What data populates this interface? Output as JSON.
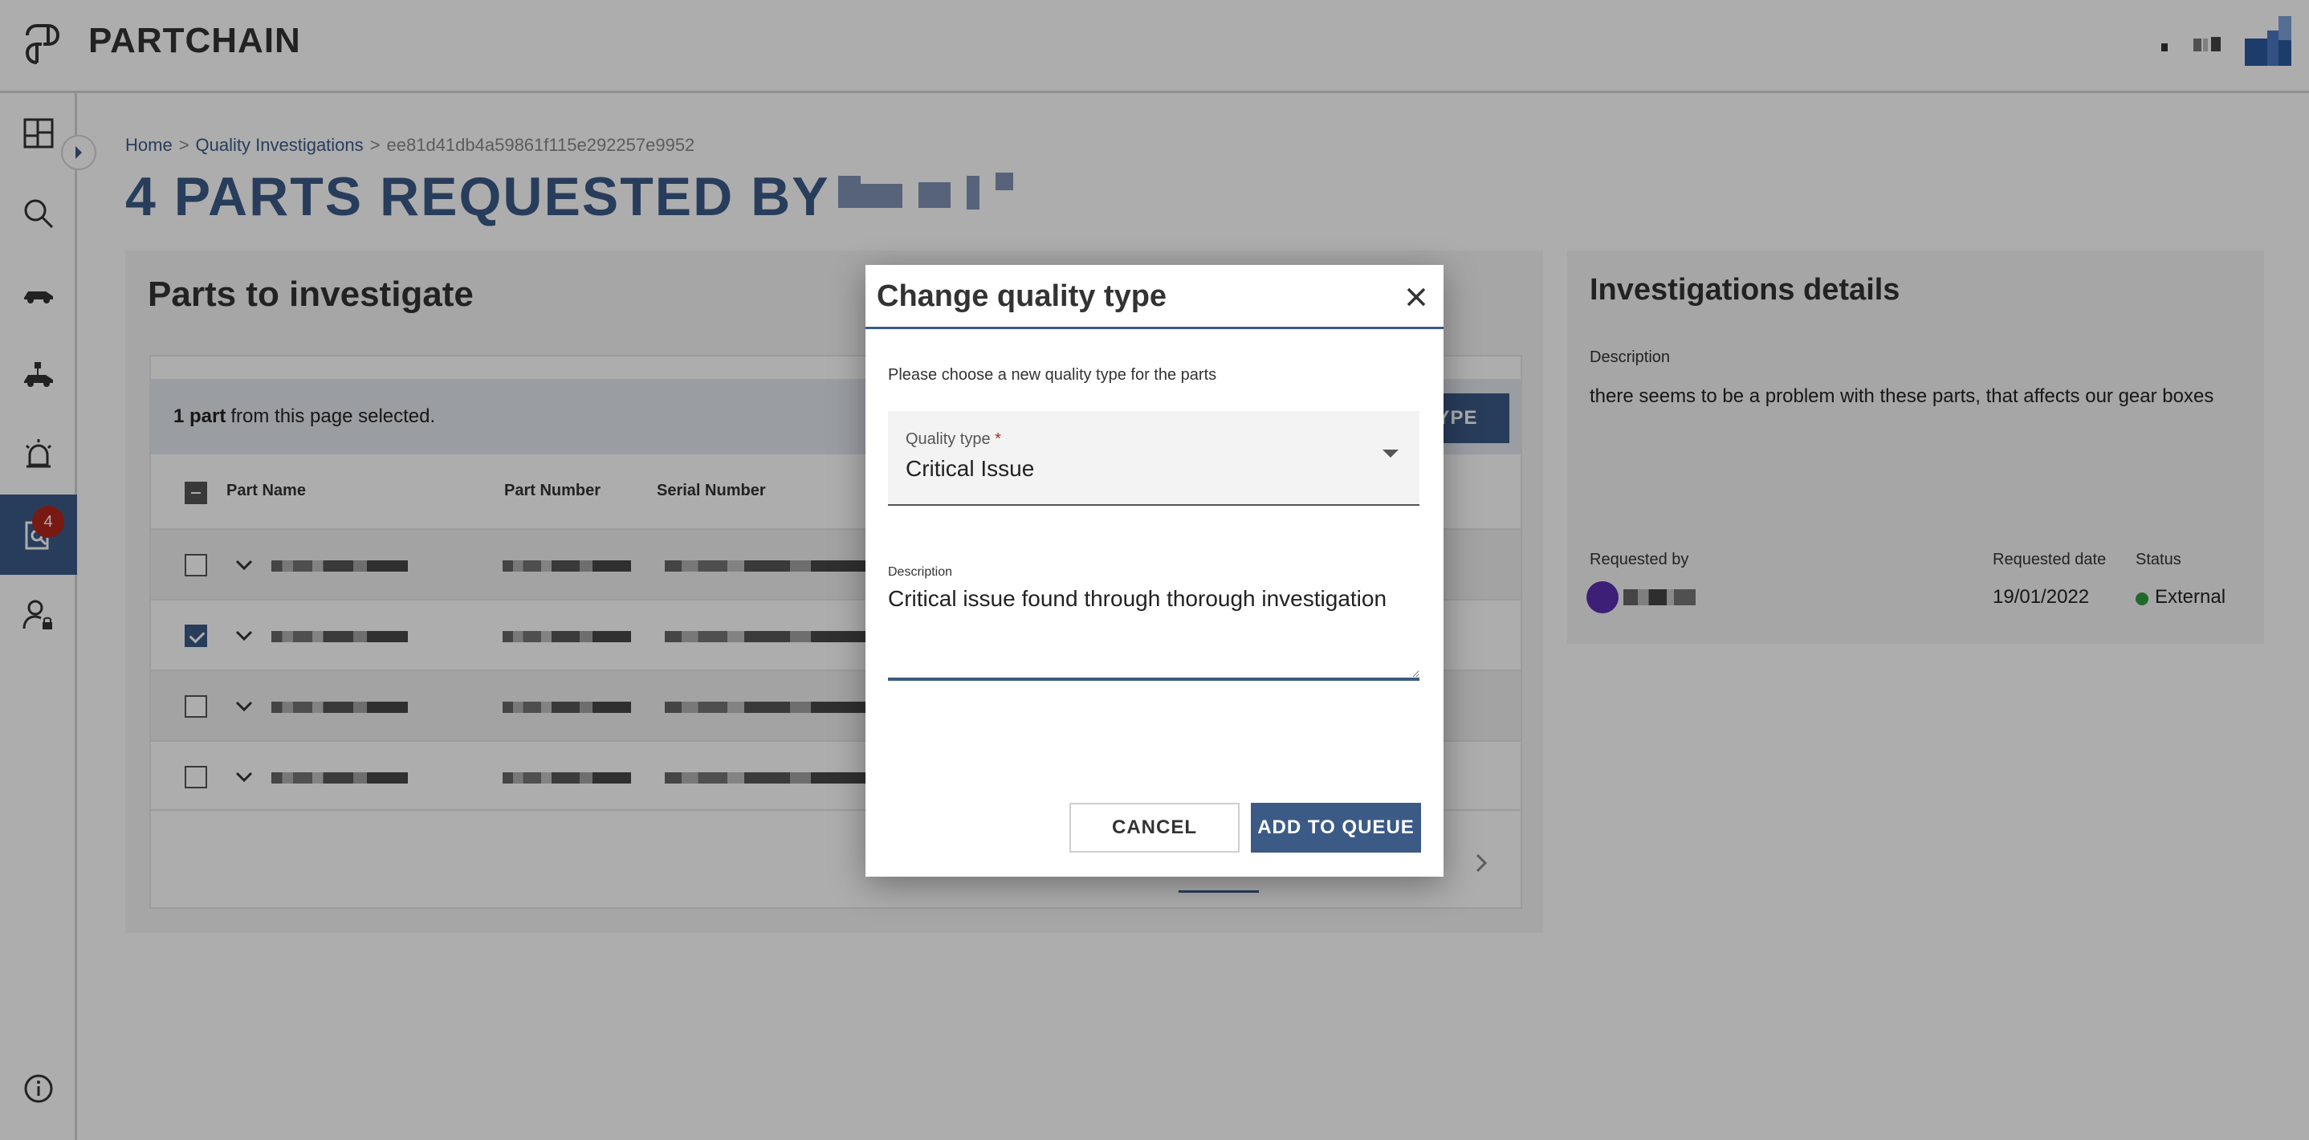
{
  "header": {
    "app_title": "PARTCHAIN",
    "logo_icon": "chain-link-icon"
  },
  "sidebar": {
    "items": [
      {
        "name": "dashboard",
        "icon": "dashboard-icon"
      },
      {
        "name": "search",
        "icon": "search-icon"
      },
      {
        "name": "own-parts",
        "icon": "car-icon"
      },
      {
        "name": "other-parts",
        "icon": "cars-network-icon"
      },
      {
        "name": "alerts",
        "icon": "siren-icon"
      },
      {
        "name": "investigations",
        "icon": "investigation-icon",
        "badge": "4",
        "active": true
      },
      {
        "name": "admin",
        "icon": "user-lock-icon"
      }
    ],
    "bottom_icon": "info-icon"
  },
  "breadcrumb": {
    "home": "Home",
    "section": "Quality Investigations",
    "current": "ee81d41db4a59861f115e292257e9952"
  },
  "page": {
    "title": "4 PARTS REQUESTED BY"
  },
  "parts_card": {
    "heading": "Parts to investigate",
    "selection": {
      "count": "1 part",
      "suffix": "from this page selected."
    },
    "type_button_label": "Y TYPE",
    "columns": [
      "Part Name",
      "Part Number",
      "Serial Number"
    ],
    "rows": [
      {
        "checked": false
      },
      {
        "checked": true
      },
      {
        "checked": false
      },
      {
        "checked": false
      }
    ]
  },
  "details_card": {
    "heading": "Investigations details",
    "description_label": "Description",
    "description": "there seems to be a problem with these parts, that affects our gear boxes",
    "requested_by_label": "Requested by",
    "requested_date_label": "Requested date",
    "requested_date": "19/01/2022",
    "status_label": "Status",
    "status": "External",
    "status_color": "#2e9c3f"
  },
  "dialog": {
    "title": "Change quality type",
    "instruction": "Please choose a new quality type for the parts",
    "quality_type_label": "Quality type",
    "required_marker": "*",
    "quality_type_value": "Critical Issue",
    "description_label": "Description",
    "description_value": "Critical issue found through thorough investigation",
    "cancel_label": "CANCEL",
    "submit_label": "ADD TO QUEUE"
  },
  "colors": {
    "primary": "#3b5a86",
    "badge": "#b3261e"
  }
}
